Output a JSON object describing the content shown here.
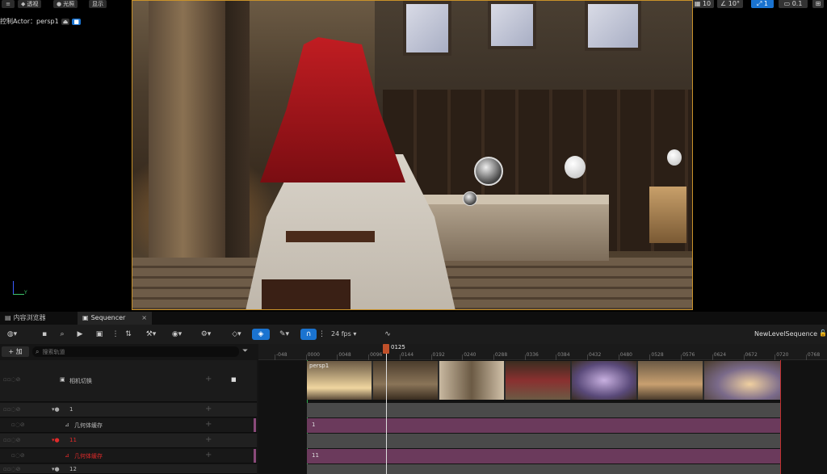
{
  "viewport": {
    "menu_icon": "hamburger-icon",
    "perspective_label": "透视",
    "lit_label": "光照",
    "show_label": "显示",
    "pilot_label": "控制Actor：persp1",
    "eject_icon": "eject-icon",
    "camera_icon": "camera-icon",
    "toolbar": {
      "select_icon": "cursor-icon",
      "move_icon": "move-icon",
      "rotate_icon": "rotate-icon",
      "scale_icon": "scale-icon",
      "world_icon": "globe-icon",
      "surface_icon": "surface-snap-icon",
      "grid_snap_value": "10",
      "rotate_snap_value": "10°",
      "scale_snap_value": "1",
      "camera_speed_value": "0.1"
    },
    "axis_gizmo_label": "Y"
  },
  "tabs": [
    {
      "label": "内容浏览器",
      "icon": "folder-icon"
    },
    {
      "label": "Sequencer",
      "icon": "clapper-icon",
      "close": "×"
    }
  ],
  "sequencer": {
    "toolbar": {
      "fps": "24 fps",
      "sequence_name": "NewLevelSequence"
    },
    "add_label": "+ 加",
    "search_placeholder": "搜索轨道",
    "current_frame": "0125",
    "tracks": [
      {
        "label": "相机切换",
        "type": "camera-cuts"
      },
      {
        "label": "1",
        "type": "actor"
      },
      {
        "label": "几何体缓存",
        "type": "sub",
        "color": "#cfcfcf"
      },
      {
        "label": "11",
        "type": "actor",
        "color": "#e02a2a"
      },
      {
        "label": "几何体缓存",
        "type": "sub",
        "color": "#e02a2a"
      },
      {
        "label": "12",
        "type": "actor"
      }
    ],
    "ruler_ticks": [
      "-048",
      "0000",
      "0048",
      "0096",
      "0144",
      "0192",
      "0240",
      "0288",
      "0336",
      "0384",
      "0432",
      "0480",
      "0528",
      "0576",
      "0624",
      "0672",
      "0720",
      "0768"
    ],
    "camera_clip_label": "persp1",
    "geo_clip_1_label": "1",
    "geo_clip_2_label": "11"
  },
  "colors": {
    "accent": "#1a73d0",
    "geo_track": "#6b3a5c",
    "playhead": "#c0502a"
  }
}
